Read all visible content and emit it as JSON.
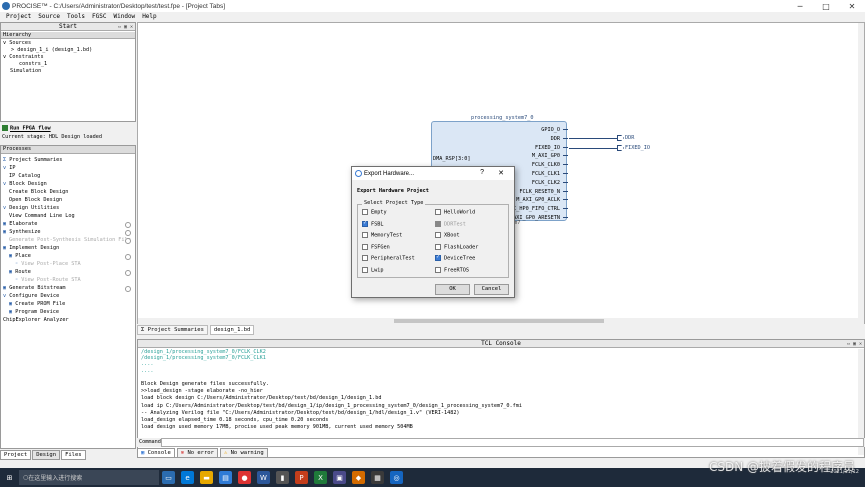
{
  "window": {
    "title": "PROCISE™ - C:/Users/Administrator/Desktop/test/test.fpe - [Project Tabs]"
  },
  "menu": [
    "Project",
    "Source",
    "Tools",
    "FGSC",
    "Window",
    "Help"
  ],
  "start_panel": {
    "title": "Start",
    "hierarchy_label": "Hierarchy",
    "tree": [
      "Sources",
      "design_1_i (design_1.bd)",
      "Constraints",
      "constrs_1",
      "Simulation"
    ]
  },
  "flow": {
    "run_label": "Run FPGA flow",
    "stage": "Current stage: HDL Design loaded"
  },
  "processes": {
    "title": "Processes",
    "items": [
      "Project Summaries",
      "IP",
      "IP Catalog",
      "Block Design",
      "Create Block Design",
      "Open Block Design",
      "Design Utilities",
      "View Command Line Log",
      "Elaborate",
      "Synthesize",
      "Generate Post-Synthesis Simulation File",
      "Implement Design",
      "Place",
      "View Post-Place STA",
      "Route",
      "View Post-Route STA",
      "Generate Bitstream",
      "Configure Device",
      "Create PROM File",
      "Program Device",
      "ChipExplorer Analyzer"
    ]
  },
  "bottom_tabs": [
    "Project",
    "Design",
    "Files"
  ],
  "block": {
    "name": "processing_system7_0",
    "left_port": "DMA_RSP[3:0]",
    "ports": [
      "GPIO_O",
      "DDR",
      "FIXED_IO",
      "M_AXI_GP0",
      "FCLK_CLK0",
      "FCLK_CLK1",
      "FCLK_CLK2",
      "FCLK_RESET0_N",
      "M_AXI_GP0_ACLK",
      "S_AXI_HP0_FIFO_CTRL",
      "M_AXI_GP0_ARESETN"
    ],
    "ext": [
      "DDR",
      "FIXED_IO"
    ],
    "suffix": "em7"
  },
  "doc_tabs": [
    "Project Summaries",
    "design_1.bd"
  ],
  "dialog": {
    "title": "Export Hardware...",
    "help": "?",
    "close": "✕",
    "heading": "Export Hardware Project",
    "group": "Select Project Type",
    "left": [
      {
        "label": "Empty",
        "state": "off"
      },
      {
        "label": "FSBL",
        "state": "on"
      },
      {
        "label": "MemoryTest",
        "state": "off"
      },
      {
        "label": "FSFGen",
        "state": "off"
      },
      {
        "label": "PeripheralTest",
        "state": "off"
      },
      {
        "label": "Lwip",
        "state": "off"
      }
    ],
    "right": [
      {
        "label": "HelloWorld",
        "state": "off"
      },
      {
        "label": "DDRTest",
        "state": "dis"
      },
      {
        "label": "XBoot",
        "state": "off"
      },
      {
        "label": "FlashLoader",
        "state": "off"
      },
      {
        "label": "DeviceTree",
        "state": "on"
      },
      {
        "label": "FreeRTOS",
        "state": "off"
      }
    ],
    "ok": "OK",
    "cancel": "Cancel"
  },
  "console": {
    "title": "TCL Console",
    "lines_teal": [
      "/design_1/processing_system7_0/FCLK_CLK2",
      "/design_1/processing_system7_0/FCLK_CLK1",
      "...."
    ],
    "lines": [
      "Block Design generate files successfully.",
      ">>load_design -stage elaborate -no_hier",
      "  load block design C:/Users/Administrator/Desktop/test/bd/design_1/design_1.bd",
      "  load ip C:/Users/Administrator/Desktop/test/bd/design_1/ip/design_1_processing_system7_0/design_1_processing_system7_0.fmi",
      "  -- Analyzing Verilog file \"C:/Users/Administrator/Desktop/test/bd/design_1/hdl/design_1.v\" (VERI-1482)",
      "  load_design elapsed_time 0.18 seconds, cpu_time 0.20 seconds",
      "  load design used memory 17MB, procise used peak memory 901MB, current used memory 504MB"
    ],
    "prompt": "Command:",
    "tabs": [
      "Console",
      "No error",
      "No warning"
    ]
  },
  "taskbar": {
    "search": "在这里输入进行搜索",
    "time": "2021/11/12",
    "watermark": "CSDN @披着假发的程序员"
  },
  "colors": {
    "accent": "#3a7bd5",
    "block_fill": "#dbe7f5",
    "block_border": "#7da2c9",
    "teal": "#2aa198",
    "taskbar": "#1e2a3a"
  }
}
